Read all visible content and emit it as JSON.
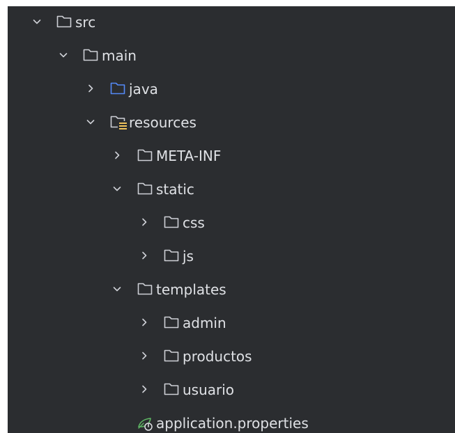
{
  "colors": {
    "panel_background": "#2b2d30",
    "text": "#dfe1e5",
    "folder_icon": "#ced0d6",
    "source_folder_icon": "#548af7",
    "resources_marker": "#f2c55c",
    "properties_icon": "#5fb865"
  },
  "project_tree": {
    "items": [
      {
        "label": "src",
        "expanded": true,
        "icon": "folder-icon"
      },
      {
        "label": "main",
        "expanded": true,
        "icon": "folder-icon"
      },
      {
        "label": "java",
        "expanded": false,
        "icon": "source-folder-icon"
      },
      {
        "label": "resources",
        "expanded": true,
        "icon": "resources-folder-icon"
      },
      {
        "label": "META-INF",
        "expanded": false,
        "icon": "folder-icon"
      },
      {
        "label": "static",
        "expanded": true,
        "icon": "folder-icon"
      },
      {
        "label": "css",
        "expanded": false,
        "icon": "folder-icon"
      },
      {
        "label": "js",
        "expanded": false,
        "icon": "folder-icon"
      },
      {
        "label": "templates",
        "expanded": true,
        "icon": "folder-icon"
      },
      {
        "label": "admin",
        "expanded": false,
        "icon": "folder-icon"
      },
      {
        "label": "productos",
        "expanded": false,
        "icon": "folder-icon"
      },
      {
        "label": "usuario",
        "expanded": false,
        "icon": "folder-icon"
      },
      {
        "label": "application.properties",
        "icon": "properties-file-icon"
      }
    ]
  }
}
